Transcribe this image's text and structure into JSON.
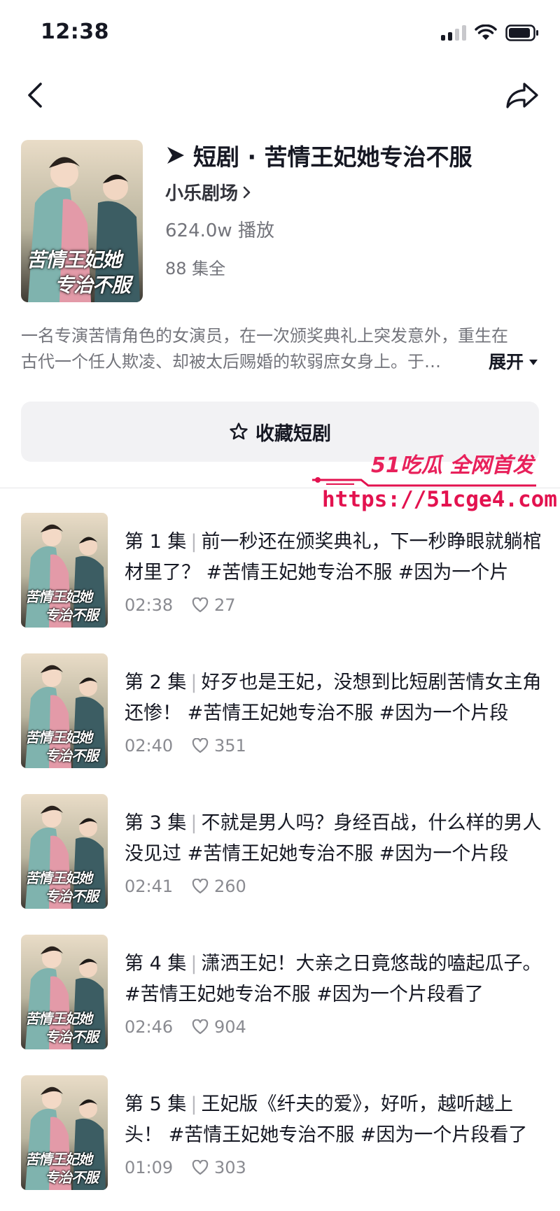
{
  "status_bar": {
    "time": "12:38"
  },
  "header": {
    "title": "短剧 · 苦情王妃她专治不服",
    "studio": "小乐剧场",
    "plays": "624.0w 播放",
    "episodes_total": "88 集全",
    "poster_text_line1": "苦情王妃她",
    "poster_text_line2": "专治不服"
  },
  "description": {
    "line1": "一名专演苦情角色的女演员，在一次颁奖典礼上突发意外，重生在",
    "line2": "古代一个任人欺凌、却被太后赐婚的软弱庶女身上。于…",
    "expand_label": "展开"
  },
  "favorite_button": {
    "label": "收藏短剧"
  },
  "watermark": {
    "top": "51吃瓜 全网首发",
    "url": "https://51cge4.com"
  },
  "episodes": [
    {
      "label": "第 1 集",
      "title": "前一秒还在颁奖典礼，下一秒睁眼就躺棺材里了？ #苦情王妃她专治不服 #因为一个片",
      "duration": "02:38",
      "likes": "27"
    },
    {
      "label": "第 2 集",
      "title": "好歹也是王妃，没想到比短剧苦情女主角还惨！ #苦情王妃她专治不服 #因为一个片段",
      "duration": "02:40",
      "likes": "351"
    },
    {
      "label": "第 3 集",
      "title": "不就是男人吗？身经百战，什么样的男人没见过 #苦情王妃她专治不服 #因为一个片段",
      "duration": "02:41",
      "likes": "260"
    },
    {
      "label": "第 4 集",
      "title": "潇洒王妃！大亲之日竟悠哉的嗑起瓜子。 #苦情王妃她专治不服 #因为一个片段看了",
      "duration": "02:46",
      "likes": "904"
    },
    {
      "label": "第 5 集",
      "title": "王妃版《纤夫的爱》，好听，越听越上头！ #苦情王妃她专治不服 #因为一个片段看了",
      "duration": "01:09",
      "likes": "303"
    }
  ],
  "colors": {
    "accent_watermark": "#e3124f",
    "text_primary": "#161823",
    "text_secondary": "#73747b"
  }
}
